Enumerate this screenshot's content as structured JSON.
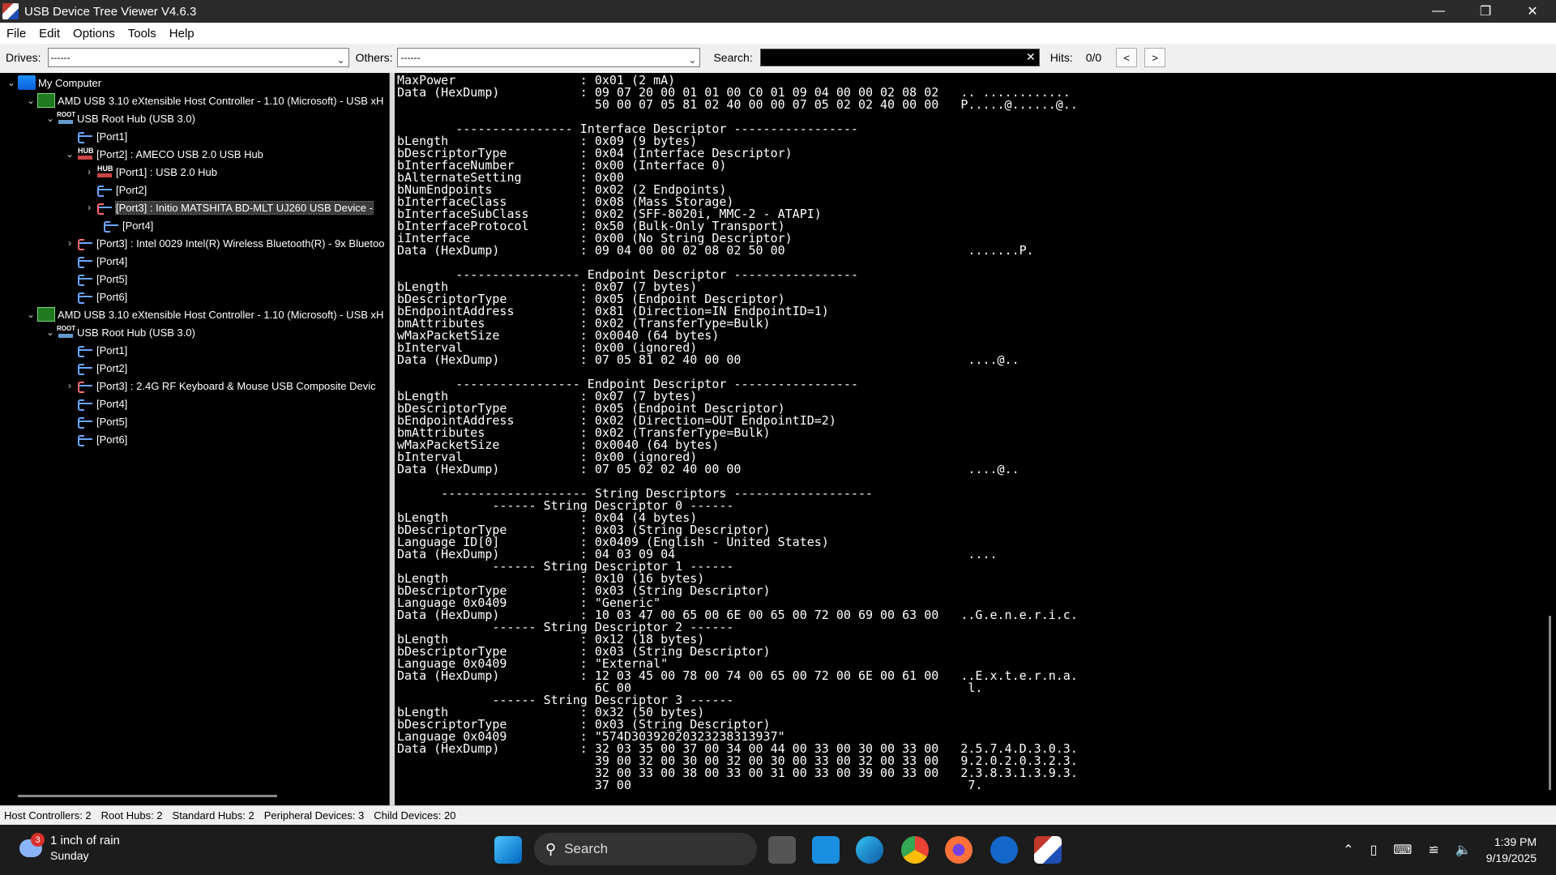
{
  "window": {
    "title": "USB Device Tree Viewer V4.6.3"
  },
  "menu": [
    "File",
    "Edit",
    "Options",
    "Tools",
    "Help"
  ],
  "toolbar": {
    "drives_label": "Drives:",
    "drives_value": "------",
    "others_label": "Others:",
    "others_value": "------",
    "search_label": "Search:",
    "search_value": "",
    "hits_label": "Hits:",
    "hits_value": "0/0",
    "prev_label": "<",
    "next_label": ">"
  },
  "tree": [
    {
      "label": "My Computer",
      "toggle": "v",
      "icon": "pc"
    },
    {
      "label": "AMD USB 3.10 eXtensible Host Controller - 1.10 (Microsoft) - USB xH",
      "toggle": "v",
      "icon": "ctrl"
    },
    {
      "label": "USB Root Hub (USB 3.0)",
      "toggle": "v",
      "icon": "root"
    },
    {
      "label": "[Port1]",
      "toggle": "",
      "icon": "port"
    },
    {
      "label": "[Port2] : AMECO USB 2.0 USB Hub",
      "toggle": "v",
      "icon": "hub"
    },
    {
      "label": "[Port1] : USB 2.0 Hub",
      "toggle": ">",
      "icon": "hub"
    },
    {
      "label": "[Port2]",
      "toggle": "",
      "icon": "port"
    },
    {
      "label": "[Port3] : Initio MATSHITA BD-MLT UJ260 USB Device -",
      "toggle": ">",
      "icon": "dev"
    },
    {
      "label": "[Port4]",
      "toggle": "",
      "icon": "port"
    },
    {
      "label": "[Port3] : Intel 0029 Intel(R) Wireless Bluetooth(R) - 9x Bluetoo",
      "toggle": ">",
      "icon": "dev"
    },
    {
      "label": "[Port4]",
      "toggle": "",
      "icon": "port"
    },
    {
      "label": "[Port5]",
      "toggle": "",
      "icon": "port"
    },
    {
      "label": "[Port6]",
      "toggle": "",
      "icon": "port"
    },
    {
      "label": "AMD USB 3.10 eXtensible Host Controller - 1.10 (Microsoft) - USB xH",
      "toggle": "v",
      "icon": "ctrl"
    },
    {
      "label": "USB Root Hub (USB 3.0)",
      "toggle": "v",
      "icon": "root"
    },
    {
      "label": "[Port1]",
      "toggle": "",
      "icon": "port"
    },
    {
      "label": "[Port2]",
      "toggle": "",
      "icon": "port"
    },
    {
      "label": "[Port3] : 2.4G RF Keyboard & Mouse USB Composite Devic",
      "toggle": ">",
      "icon": "dev"
    },
    {
      "label": "[Port4]",
      "toggle": "",
      "icon": "port"
    },
    {
      "label": "[Port5]",
      "toggle": "",
      "icon": "port"
    },
    {
      "label": "[Port6]",
      "toggle": "",
      "icon": "port"
    }
  ],
  "detail_text": "MaxPower                 : 0x01 (2 mA)\nData (HexDump)           : 09 07 20 00 01 01 00 C0 01 09 04 00 00 02 08 02   .. ............\n                           50 00 07 05 81 02 40 00 00 07 05 02 02 40 00 00   P.....@......@..\n\n        ---------------- Interface Descriptor -----------------\nbLength                  : 0x09 (9 bytes)\nbDescriptorType          : 0x04 (Interface Descriptor)\nbInterfaceNumber         : 0x00 (Interface 0)\nbAlternateSetting        : 0x00\nbNumEndpoints            : 0x02 (2 Endpoints)\nbInterfaceClass          : 0x08 (Mass Storage)\nbInterfaceSubClass       : 0x02 (SFF-8020i, MMC-2 - ATAPI)\nbInterfaceProtocol       : 0x50 (Bulk-Only Transport)\niInterface               : 0x00 (No String Descriptor)\nData (HexDump)           : 09 04 00 00 02 08 02 50 00                         .......P.\n\n        ----------------- Endpoint Descriptor -----------------\nbLength                  : 0x07 (7 bytes)\nbDescriptorType          : 0x05 (Endpoint Descriptor)\nbEndpointAddress         : 0x81 (Direction=IN EndpointID=1)\nbmAttributes             : 0x02 (TransferType=Bulk)\nwMaxPacketSize           : 0x0040 (64 bytes)\nbInterval                : 0x00 (ignored)\nData (HexDump)           : 07 05 81 02 40 00 00                               ....@..\n\n        ----------------- Endpoint Descriptor -----------------\nbLength                  : 0x07 (7 bytes)\nbDescriptorType          : 0x05 (Endpoint Descriptor)\nbEndpointAddress         : 0x02 (Direction=OUT EndpointID=2)\nbmAttributes             : 0x02 (TransferType=Bulk)\nwMaxPacketSize           : 0x0040 (64 bytes)\nbInterval                : 0x00 (ignored)\nData (HexDump)           : 07 05 02 02 40 00 00                               ....@..\n\n      -------------------- String Descriptors -------------------\n             ------ String Descriptor 0 ------\nbLength                  : 0x04 (4 bytes)\nbDescriptorType          : 0x03 (String Descriptor)\nLanguage ID[0]           : 0x0409 (English - United States)\nData (HexDump)           : 04 03 09 04                                        ....\n             ------ String Descriptor 1 ------\nbLength                  : 0x10 (16 bytes)\nbDescriptorType          : 0x03 (String Descriptor)\nLanguage 0x0409          : \"Generic\"\nData (HexDump)           : 10 03 47 00 65 00 6E 00 65 00 72 00 69 00 63 00   ..G.e.n.e.r.i.c.\n             ------ String Descriptor 2 ------\nbLength                  : 0x12 (18 bytes)\nbDescriptorType          : 0x03 (String Descriptor)\nLanguage 0x0409          : \"External\"\nData (HexDump)           : 12 03 45 00 78 00 74 00 65 00 72 00 6E 00 61 00   ..E.x.t.e.r.n.a.\n                           6C 00                                              l.\n             ------ String Descriptor 3 ------\nbLength                  : 0x32 (50 bytes)\nbDescriptorType          : 0x03 (String Descriptor)\nLanguage 0x0409          : \"574D30392020323238313937\"\nData (HexDump)           : 32 03 35 00 37 00 34 00 44 00 33 00 30 00 33 00   2.5.7.4.D.3.0.3.\n                           39 00 32 00 30 00 32 00 30 00 33 00 32 00 33 00   9.2.0.2.0.3.2.3.\n                           32 00 33 00 38 00 33 00 31 00 33 00 39 00 33 00   2.3.8.3.1.3.9.3.\n                           37 00                                              7.",
  "status": {
    "host_controllers": "Host Controllers: 2",
    "root_hubs": "Root Hubs: 2",
    "standard_hubs": "Standard Hubs: 2",
    "peripheral_devices": "Peripheral Devices: 3",
    "child_devices": "Child Devices: 20"
  },
  "taskbar": {
    "weather_badge": "3",
    "weather_line1": "1 inch of rain",
    "weather_line2": "Sunday",
    "search_label": "Search",
    "time": "1:39 PM",
    "date": "9/19/2025"
  }
}
